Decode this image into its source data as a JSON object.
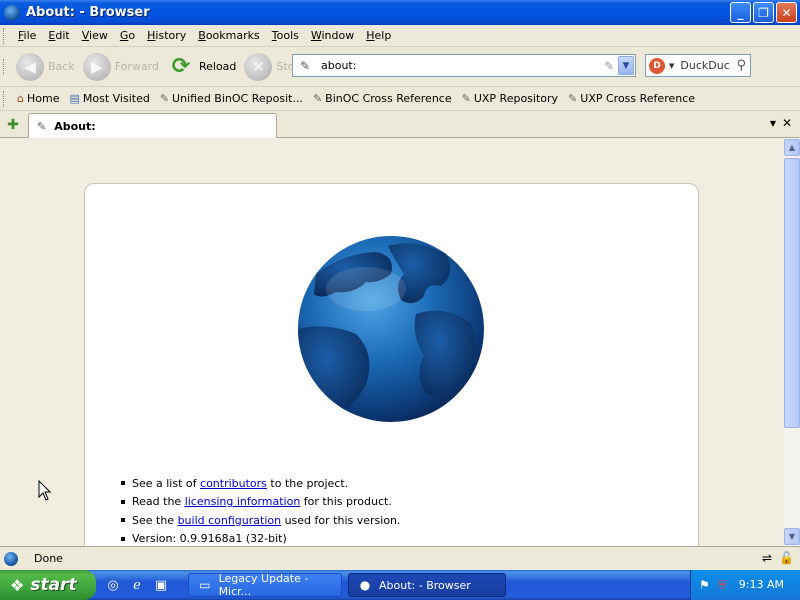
{
  "window": {
    "title": "About: - Browser"
  },
  "menubar": {
    "items": [
      "File",
      "Edit",
      "View",
      "Go",
      "History",
      "Bookmarks",
      "Tools",
      "Window",
      "Help"
    ]
  },
  "toolbar": {
    "back_label": "Back",
    "forward_label": "Forward",
    "reload_label": "Reload",
    "stop_label": "Stop"
  },
  "urlbar": {
    "value": "about:"
  },
  "searchbar": {
    "engine": "DuckDuc"
  },
  "bookmarks": {
    "items": [
      "Home",
      "Most Visited",
      "Unified BinOC Reposit...",
      "BinOC Cross Reference",
      "UXP Repository",
      "UXP Cross Reference"
    ]
  },
  "tabs": [
    {
      "label": "About:"
    }
  ],
  "about": {
    "line1": {
      "pre": "See a list of ",
      "link": "contributors",
      "post": " to the project."
    },
    "line2": {
      "pre": "Read the ",
      "link": "licensing information",
      "post": " for this product."
    },
    "line3": {
      "pre": "See the ",
      "link": "build configuration",
      "post": " used for this version."
    },
    "line4": {
      "text": "Version: 0.9.9168a1 (32-bit)"
    }
  },
  "status": {
    "text": "Done"
  },
  "taskbar": {
    "start_label": "start",
    "tasks": [
      {
        "label": "Legacy Update - Micr..."
      },
      {
        "label": "About: - Browser"
      }
    ],
    "clock": "9:13 AM"
  },
  "colors": {
    "titlebar": "#0054e3",
    "link": "#0000cc",
    "start_green": "#3ea63e",
    "taskbar_blue": "#245edb"
  }
}
